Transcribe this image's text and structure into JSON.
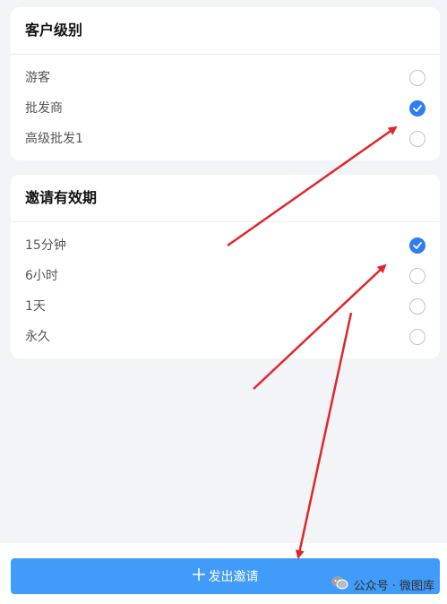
{
  "customer_level": {
    "title": "客户级别",
    "options": [
      {
        "label": "游客",
        "checked": false
      },
      {
        "label": "批发商",
        "checked": true
      },
      {
        "label": "高级批发1",
        "checked": false
      }
    ]
  },
  "invite_validity": {
    "title": "邀请有效期",
    "options": [
      {
        "label": "15分钟",
        "checked": true
      },
      {
        "label": "6小时",
        "checked": false
      },
      {
        "label": "1天",
        "checked": false
      },
      {
        "label": "永久",
        "checked": false
      }
    ]
  },
  "submit": {
    "label": "发出邀请",
    "icon": "plus-icon"
  },
  "watermark": {
    "text": "公众号 · 微图库",
    "icon": "wechat-icon"
  },
  "colors": {
    "accent": "#2f7cf6",
    "button": "#419bf9",
    "annotation_arrow": "#e0262b",
    "background": "#f3f4f8"
  }
}
